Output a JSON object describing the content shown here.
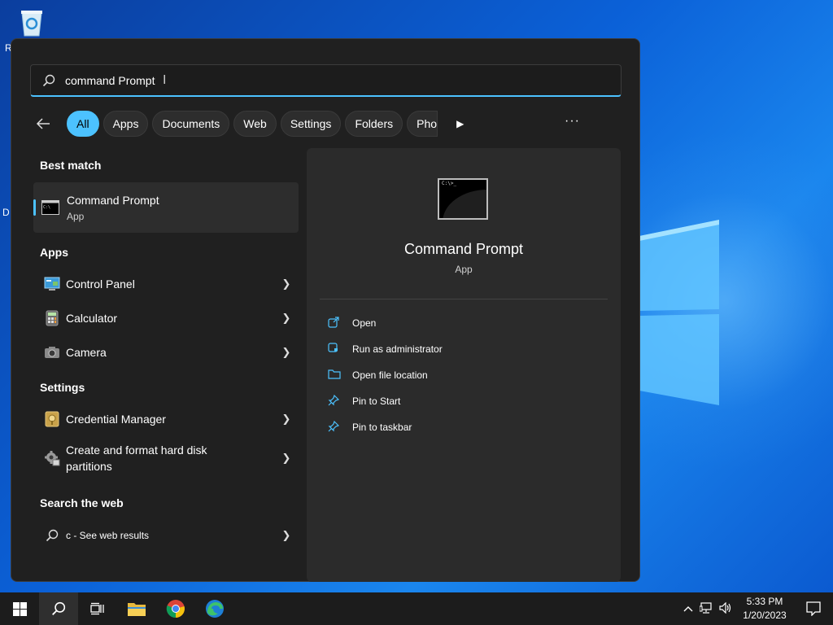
{
  "desktop": {
    "recycle_bin_label_clip": "R",
    "edge_label_clip": "D"
  },
  "search": {
    "query": "command Prompt",
    "caret_symbol": "I"
  },
  "filters": {
    "chips": [
      "All",
      "Apps",
      "Documents",
      "Web",
      "Settings",
      "Folders",
      "Pho"
    ],
    "more_symbol": "···"
  },
  "results": {
    "best_match_heading": "Best match",
    "best_match": {
      "title": "Command Prompt",
      "subtitle": "App"
    },
    "apps_heading": "Apps",
    "apps": [
      {
        "label": "Control Panel",
        "icon": "control-panel-icon"
      },
      {
        "label": "Calculator",
        "icon": "calculator-icon"
      },
      {
        "label": "Camera",
        "icon": "camera-icon"
      }
    ],
    "settings_heading": "Settings",
    "settings": [
      {
        "label": "Credential Manager",
        "icon": "credential-manager-icon"
      },
      {
        "label": "Create and format hard disk",
        "label2": "partitions",
        "icon": "disk-management-icon"
      }
    ],
    "web_heading": "Search the web",
    "web_query": "c",
    "web_suffix": " - See web results"
  },
  "preview": {
    "title": "Command Prompt",
    "subtitle": "App",
    "icon_prompt": "C:\\>_",
    "actions": [
      {
        "label": "Open",
        "icon": "open-external-icon"
      },
      {
        "label": "Run as administrator",
        "icon": "shield-admin-icon"
      },
      {
        "label": "Open file location",
        "icon": "folder-icon"
      },
      {
        "label": "Pin to Start",
        "icon": "pin-icon"
      },
      {
        "label": "Pin to taskbar",
        "icon": "pin-icon"
      }
    ]
  },
  "taskbar": {
    "apps": [
      "start",
      "search",
      "task-view",
      "file-explorer",
      "chrome",
      "edge"
    ],
    "clock_time": "5:33 PM",
    "clock_date": "1/20/2023"
  },
  "colors": {
    "accent": "#4cc2ff",
    "panel_bg": "#202020",
    "preview_bg": "#2b2b2b",
    "taskbar_bg": "#1c1c1c"
  }
}
